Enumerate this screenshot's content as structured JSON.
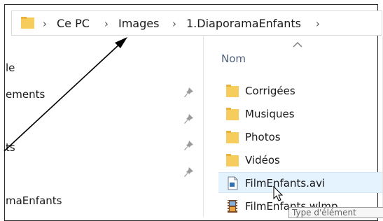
{
  "address_bar": {
    "crumbs": [
      "Ce PC",
      "Images",
      "1.DiaporamaEnfants"
    ],
    "separator": "›"
  },
  "nav_pane": {
    "items": [
      "le",
      "ements",
      "ts",
      "maEnfants"
    ]
  },
  "file_list": {
    "column_header": "Nom",
    "files": [
      {
        "name": "Corrigées",
        "icon": "folder-icon"
      },
      {
        "name": "Musiques",
        "icon": "folder-icon"
      },
      {
        "name": "Photos",
        "icon": "folder-icon"
      },
      {
        "name": "Vidéos",
        "icon": "folder-icon"
      },
      {
        "name": "FilmEnfants.avi",
        "icon": "video-file-icon"
      },
      {
        "name": "FilmEnfants.wlmp",
        "icon": "movie-project-icon"
      }
    ]
  },
  "tooltip": {
    "text": "Type d'élément"
  },
  "colors": {
    "folder": "#f6cd5c",
    "folder_tab": "#e8b339",
    "selection": "#e5f3ff",
    "arrow": "#000000"
  }
}
